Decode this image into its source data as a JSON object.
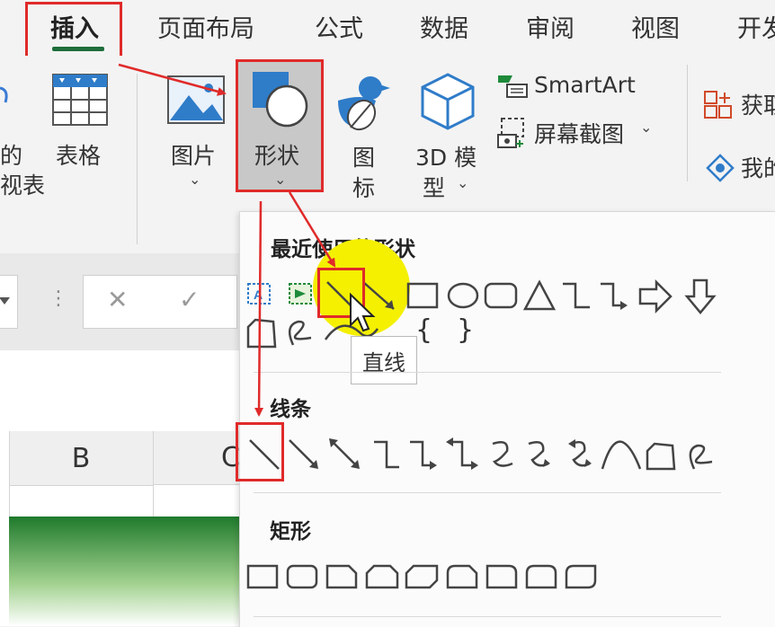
{
  "tabs": [
    "插入",
    "页面布局",
    "公式",
    "数据",
    "审阅",
    "视图",
    "开发"
  ],
  "ribbon": {
    "pivot_partial": [
      "的",
      "视表"
    ],
    "table_label": "表格",
    "picture_label": "图片",
    "shapes_label": "形状",
    "icons_label": [
      "图",
      "标"
    ],
    "model3d_label": [
      "3D 模",
      "型"
    ],
    "smartart_label": "SmartArt",
    "screenshot_label": "屏幕截图",
    "get_addins_partial": "获取",
    "my_addins_partial": "我的"
  },
  "formula_bar": {
    "cancel_symbol": "✕",
    "enter_symbol": "✓"
  },
  "columns": [
    "B",
    "C"
  ],
  "dropdown": {
    "recent_heading": "最近使用的形状",
    "lines_heading": "线条",
    "rect_heading": "矩形",
    "tooltip": "直线",
    "brace_open": "{",
    "brace_close": "}"
  },
  "colors": {
    "annotation_red": "#e02a2a",
    "tab_underline": "#1e6e3a",
    "highlight": "#f4f000",
    "selected_button": "#c8c8c8"
  }
}
